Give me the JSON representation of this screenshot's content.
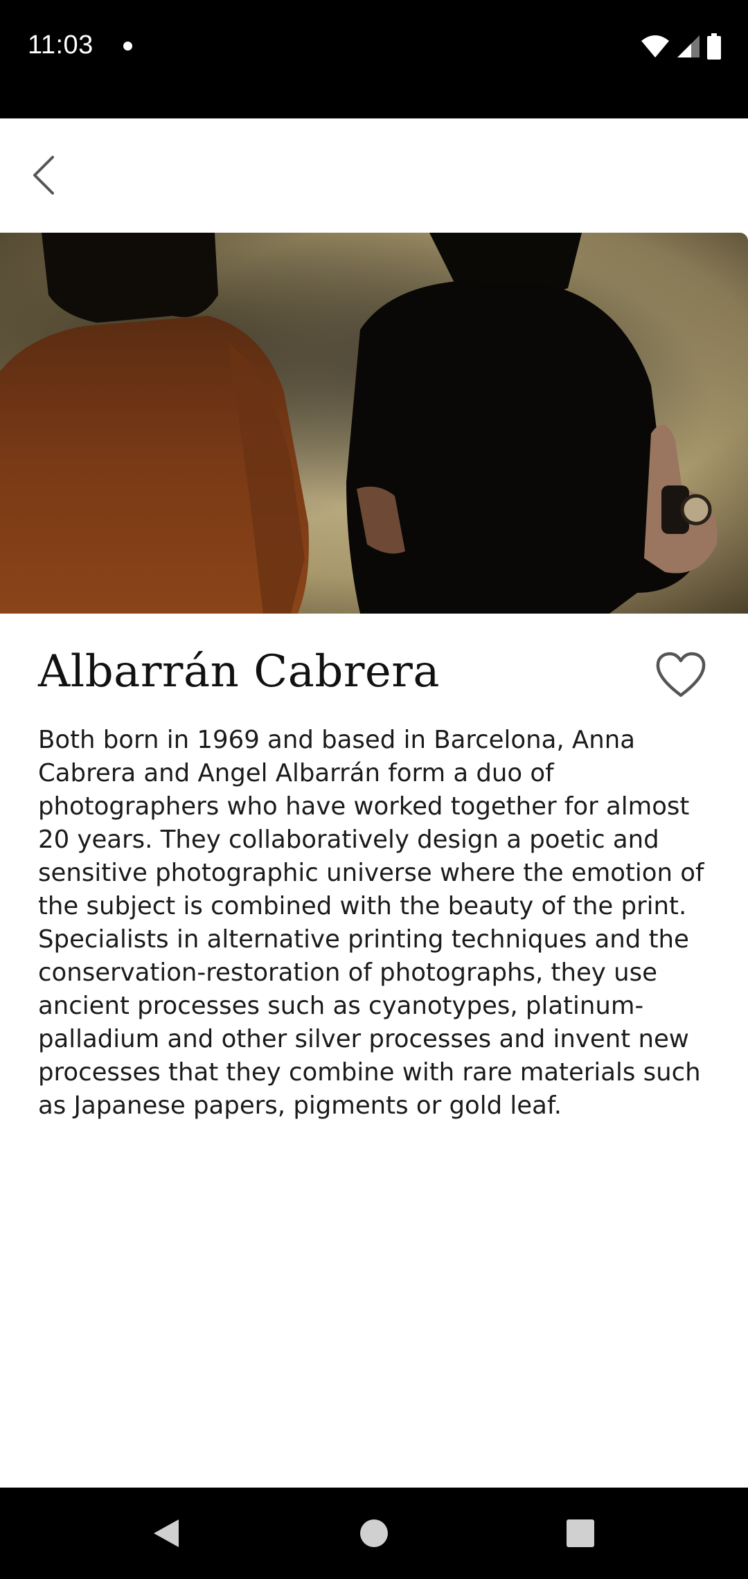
{
  "status_bar": {
    "time": "11:03",
    "icons": [
      "notification-dot-icon",
      "wifi-icon",
      "cellular-signal-icon",
      "battery-icon"
    ]
  },
  "app_bar": {
    "back_icon": "chevron-left-icon"
  },
  "artist": {
    "name": "Albarrán Cabrera",
    "favorite_icon": "heart-outline-icon",
    "bio": "Both born in 1969 and based in Barcelona, Anna Cabrera and Angel Albarrán form a duo of photographers who have worked together for almost 20 years. They collaboratively design a poetic and sensitive photographic universe where the emotion of the subject is combined with the beauty of the print. Specialists in alternative printing techniques and the conservation-restoration of photographs, they use ancient processes such as cyanotypes, platinum-palladium and other silver processes and invent new processes that they combine with rare materials such as Japanese papers, pigments or gold leaf."
  },
  "nav_bar": {
    "icons": [
      "nav-back-icon",
      "nav-home-icon",
      "nav-recents-icon"
    ]
  },
  "colors": {
    "status_bar_bg": "#000000",
    "page_bg": "#ffffff",
    "text": "#111111",
    "icon_grey": "#555555",
    "hero_wall": "#c9b98d"
  }
}
